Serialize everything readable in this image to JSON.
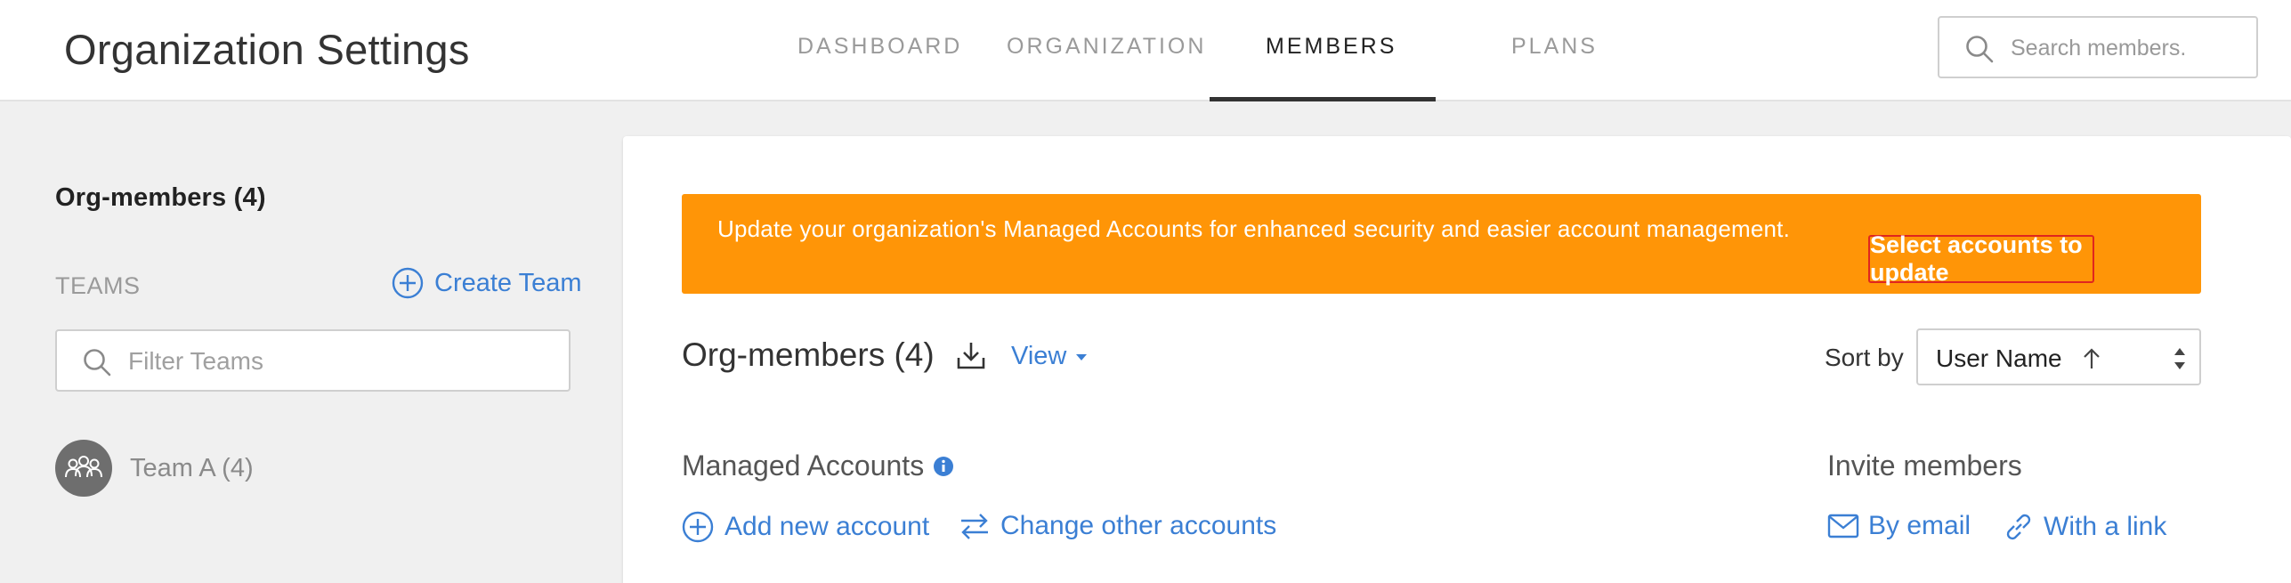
{
  "header": {
    "title": "Organization Settings",
    "tabs": [
      {
        "label": "DASHBOARD",
        "active": false
      },
      {
        "label": "ORGANIZATION",
        "active": false
      },
      {
        "label": "MEMBERS",
        "active": true
      },
      {
        "label": "PLANS",
        "active": false
      }
    ],
    "search": {
      "placeholder": "Search members.",
      "icon": "search-icon"
    }
  },
  "sidebar": {
    "title": "Org-members (4)",
    "teams_label": "TEAMS",
    "create_team_label": "Create Team",
    "filter_placeholder": "Filter Teams",
    "teams": [
      {
        "name": "Team A (4)",
        "icon": "team-group-icon"
      }
    ]
  },
  "main": {
    "banner": {
      "text": "Update your organization's Managed Accounts for enhanced security and easier account management.",
      "button_label": "Select accounts to update",
      "color": "#ff9507"
    },
    "heading": "Org-members (4)",
    "view_label": "View",
    "sort": {
      "label": "Sort by",
      "value": "User Name",
      "direction": "ascending"
    },
    "managed_accounts": {
      "label": "Managed Accounts",
      "add_label": "Add new account",
      "change_label": "Change other accounts"
    },
    "invite": {
      "label": "Invite members",
      "by_email_label": "By email",
      "with_link_label": "With a link"
    }
  },
  "colors": {
    "accent": "#3b7fd4",
    "banner": "#ff9507",
    "banner_button_border": "#e0261f"
  }
}
